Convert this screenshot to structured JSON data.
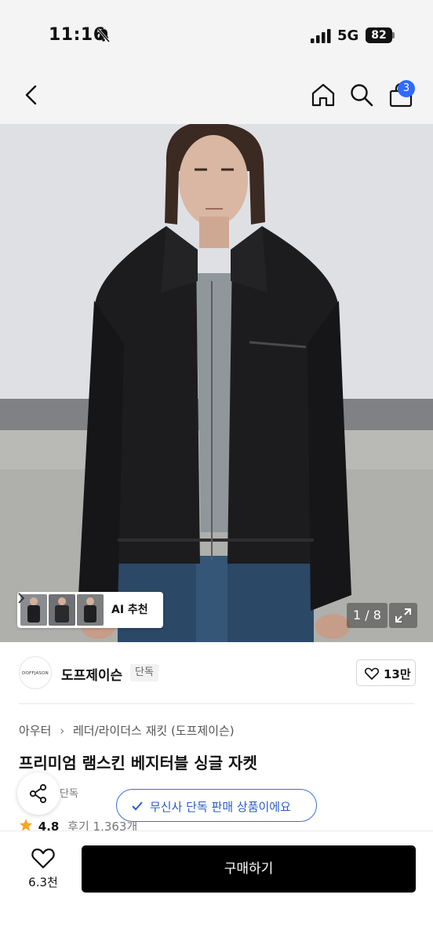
{
  "status_bar": {
    "time": "11:16",
    "network": "5G",
    "battery": "82",
    "icons": [
      "bell-slash-icon",
      "signal-icon"
    ]
  },
  "nav": {
    "icons": [
      "back-icon",
      "home-icon",
      "search-icon",
      "shopping-bag-icon"
    ],
    "cart_count": "3"
  },
  "gallery": {
    "ai_label": "AI 추천",
    "counter": "1 / 8",
    "thumbnail_count": 3
  },
  "brand": {
    "logo_text": "DOFFJASON",
    "name": "도프제이슨",
    "tag": "단독",
    "likes": "13만"
  },
  "product": {
    "breadcrumb": [
      "아우터",
      "레더/라이더스 재킷 (도프제이슨)"
    ],
    "title": "프리미엄 램스킨 베지터블 싱글 자켓",
    "tag_partial": "단독",
    "toast": "무신사 단독 판매 상품이에요",
    "rating": "4.8",
    "review_label": "후기 1,363개"
  },
  "bottom_bar": {
    "wish_count": "6.3천",
    "buy_label": "구매하기"
  },
  "colors": {
    "accent_blue": "#2f6bff",
    "toast_blue": "#2a5cc7",
    "star": "#f5a623",
    "buy_button": "#000000"
  }
}
